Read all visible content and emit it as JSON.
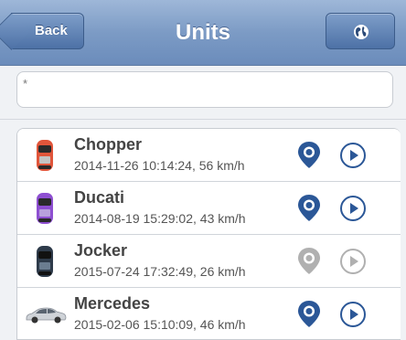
{
  "header": {
    "title": "Units",
    "back_label": "Back",
    "globe_icon": "globe-icon",
    "accent_color": "#4d71a6"
  },
  "search": {
    "value": "",
    "placeholder": "*"
  },
  "units": [
    {
      "name": "Chopper",
      "info": "2014-11-26 10:14:24, 56 km/h",
      "icon": "car-red-icon",
      "active": true
    },
    {
      "name": "Ducati",
      "info": "2014-08-19 15:29:02, 43 km/h",
      "icon": "car-purple-icon",
      "active": true
    },
    {
      "name": "Jocker",
      "info": "2015-07-24 17:32:49, 26 km/h",
      "icon": "car-dark-icon",
      "active": false
    },
    {
      "name": "Mercedes",
      "info": "2015-02-06 15:10:09, 46 km/h",
      "icon": "car-silver-icon",
      "active": true
    }
  ],
  "colors": {
    "active_icon": "#2b5797",
    "inactive_icon": "#b0b0b0"
  }
}
